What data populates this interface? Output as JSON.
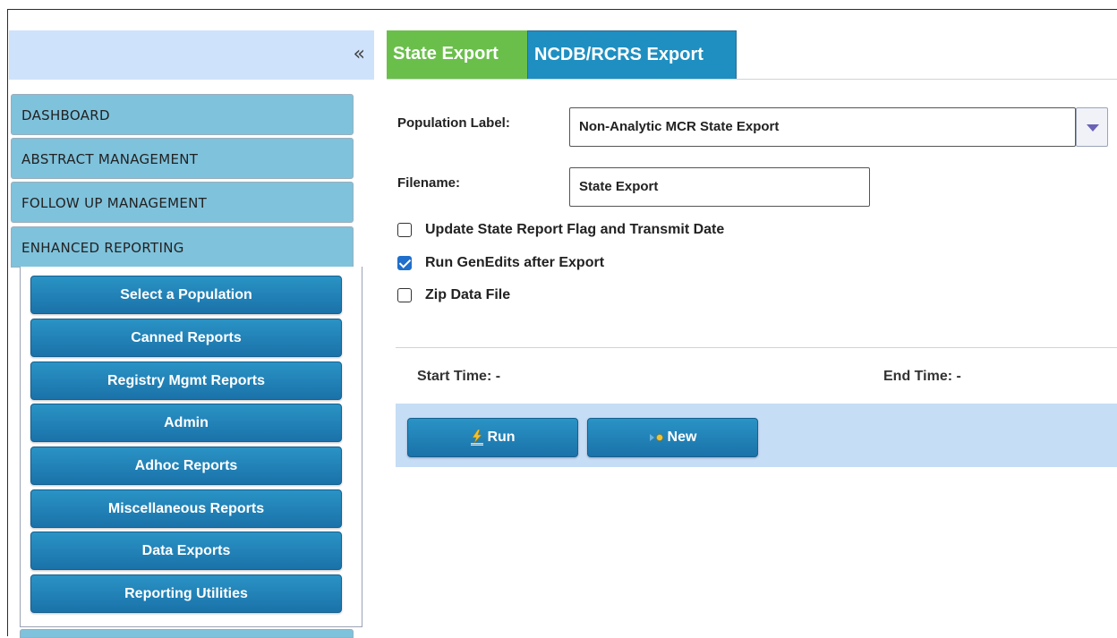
{
  "sidebar": {
    "collapse_label": "«",
    "nav": [
      {
        "label": "DASHBOARD"
      },
      {
        "label": "ABSTRACT MANAGEMENT"
      },
      {
        "label": "FOLLOW UP MANAGEMENT"
      },
      {
        "label": "ENHANCED REPORTING"
      }
    ],
    "submenu": [
      {
        "label": "Select a Population"
      },
      {
        "label": "Canned Reports"
      },
      {
        "label": "Registry Mgmt Reports"
      },
      {
        "label": "Admin"
      },
      {
        "label": "Adhoc Reports"
      },
      {
        "label": "Miscellaneous Reports"
      },
      {
        "label": "Data Exports"
      },
      {
        "label": "Reporting Utilities"
      }
    ]
  },
  "tabs": [
    {
      "label": "State Export",
      "active": true
    },
    {
      "label": "NCDB/RCRS Export",
      "active": false
    }
  ],
  "form": {
    "population_label": "Population Label:",
    "population_value": "Non-Analytic MCR State Export",
    "filename_label": "Filename:",
    "filename_value": "State Export",
    "checkboxes": [
      {
        "label": "Update State Report Flag and Transmit Date",
        "checked": false
      },
      {
        "label": "Run GenEdits after Export",
        "checked": true
      },
      {
        "label": "Zip Data File",
        "checked": false
      }
    ]
  },
  "status": {
    "start_time": "Start Time: -",
    "end_time": "End Time: -"
  },
  "actions": {
    "run_label": "Run",
    "new_label": "New"
  },
  "colors": {
    "active_tab": "#6abf4b",
    "inactive_tab": "#1f8fc1",
    "nav_item": "#7fc2dc",
    "sub_button": "#1f82b8",
    "panel_bar": "#c6ddf6",
    "checkbox_checked": "#1f6fcc"
  },
  "icons": {
    "collapse": "double-chevron-left-icon",
    "dropdown": "triangle-down-icon",
    "run": "lightning-bolt-icon",
    "new": "arrow-dot-icon"
  }
}
